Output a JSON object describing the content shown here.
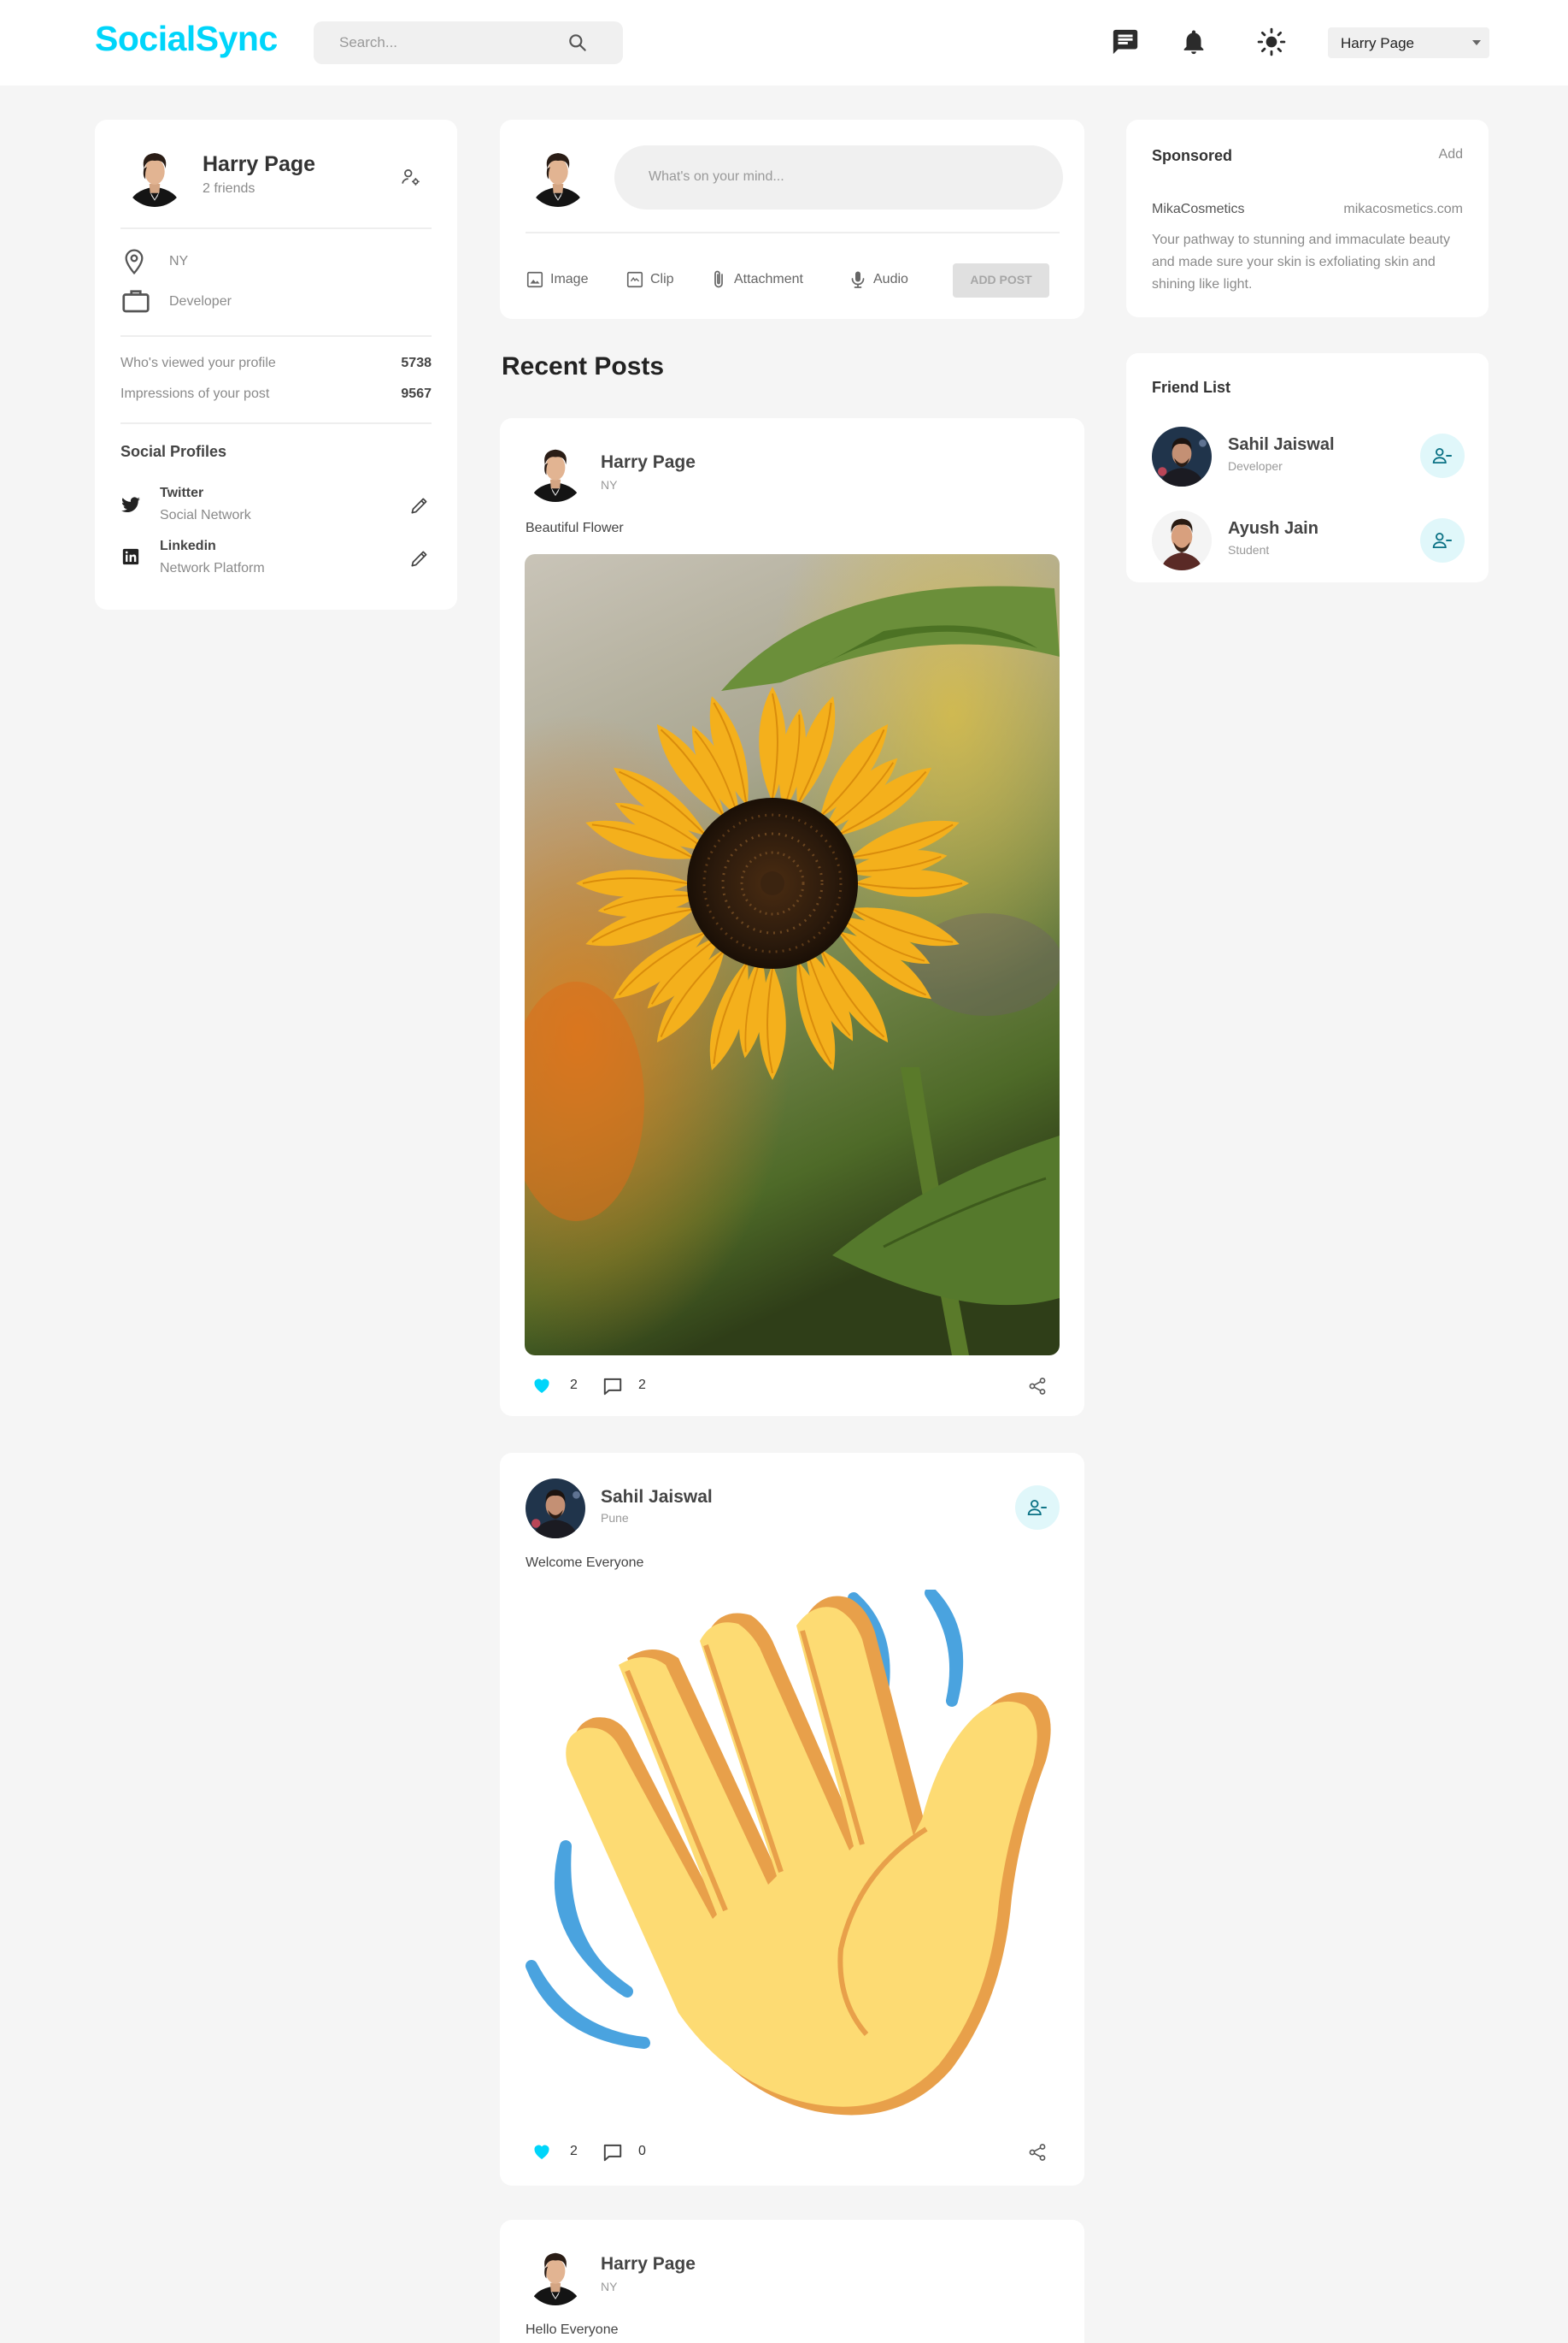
{
  "app": {
    "brand": "SocialSync"
  },
  "header": {
    "search_placeholder": "Search...",
    "user_select": "Harry Page",
    "icons": [
      "chat-icon",
      "bell-icon",
      "sun-icon"
    ]
  },
  "profile": {
    "name": "Harry Page",
    "friends": "2 friends",
    "location": "NY",
    "occupation": "Developer",
    "stats": [
      {
        "label": "Who's viewed your profile",
        "value": "5738"
      },
      {
        "label": "Impressions of your post",
        "value": "9567"
      }
    ],
    "social_title": "Social Profiles",
    "social": [
      {
        "name": "Twitter",
        "sub": "Social Network"
      },
      {
        "name": "Linkedin",
        "sub": "Network Platform"
      }
    ]
  },
  "composer": {
    "placeholder": "What's on your mind...",
    "actions": [
      "Image",
      "Clip",
      "Attachment",
      "Audio"
    ],
    "post_button": "ADD POST"
  },
  "feed": {
    "title": "Recent Posts",
    "posts": [
      {
        "author": "Harry Page",
        "location": "NY",
        "text": "Beautiful Flower",
        "likes": "2",
        "comments": "2"
      },
      {
        "author": "Sahil Jaiswal",
        "location": "Pune",
        "text": "Welcome Everyone",
        "likes": "2",
        "comments": "0"
      },
      {
        "author": "Harry Page",
        "location": "NY",
        "text": "Hello Everyone"
      }
    ]
  },
  "sponsored": {
    "title": "Sponsored",
    "add": "Add",
    "brand": "MikaCosmetics",
    "url": "mikacosmetics.com",
    "desc": "Your pathway to stunning and immaculate beauty and made sure your skin is exfoliating skin and shining like light."
  },
  "friends": {
    "title": "Friend List",
    "list": [
      {
        "name": "Sahil Jaiswal",
        "role": "Developer"
      },
      {
        "name": "Ayush Jain",
        "role": "Student"
      }
    ]
  },
  "colors": {
    "accent": "#00d5fa",
    "background": "#f5f5f5",
    "card": "#ffffff"
  }
}
